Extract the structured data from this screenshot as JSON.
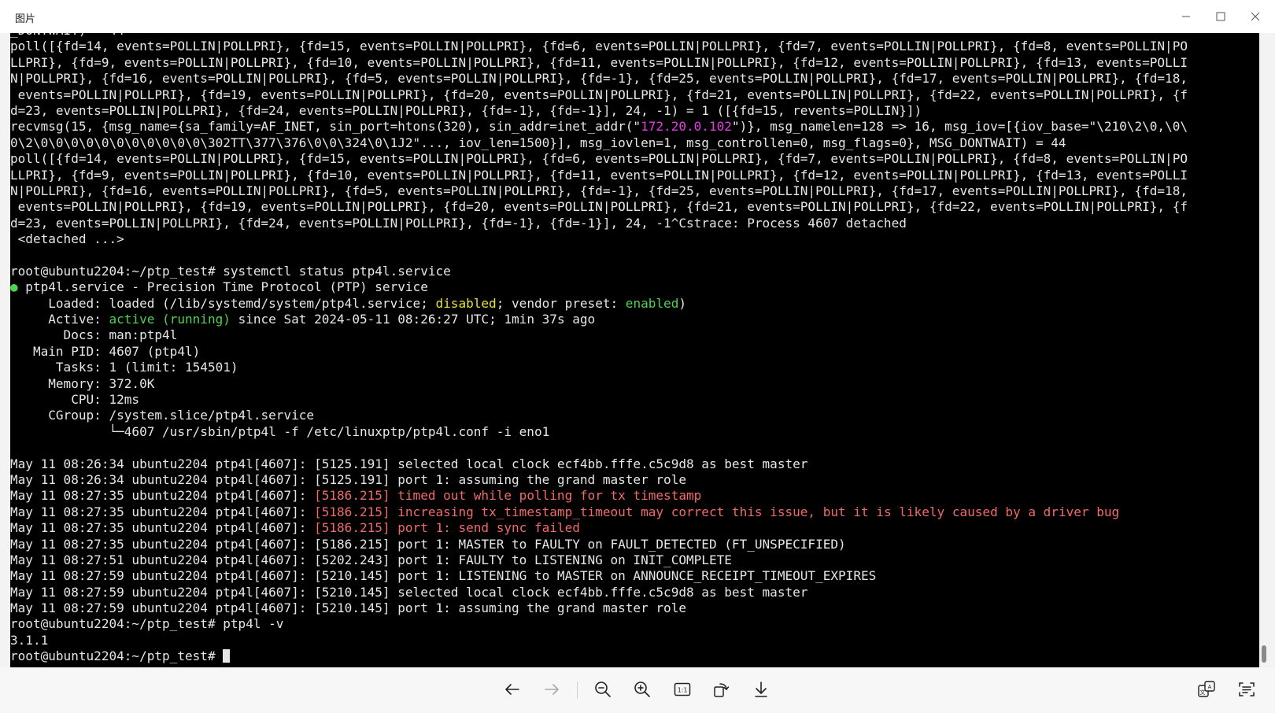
{
  "window": {
    "title": "图片"
  },
  "terminal": {
    "lines": [
      [
        {
          "t": "_DONTWAIT) = 44"
        }
      ],
      [
        {
          "t": "poll([{fd=14, events=POLLIN|POLLPRI}, {fd=15, events=POLLIN|POLLPRI}, {fd=6, events=POLLIN|POLLPRI}, {fd=7, events=POLLIN|POLLPRI}, {fd=8, events=POLLIN|PO"
        }
      ],
      [
        {
          "t": "LLPRI}, {fd=9, events=POLLIN|POLLPRI}, {fd=10, events=POLLIN|POLLPRI}, {fd=11, events=POLLIN|POLLPRI}, {fd=12, events=POLLIN|POLLPRI}, {fd=13, events=POLLI"
        }
      ],
      [
        {
          "t": "N|POLLPRI}, {fd=16, events=POLLIN|POLLPRI}, {fd=5, events=POLLIN|POLLPRI}, {fd=-1}, {fd=25, events=POLLIN|POLLPRI}, {fd=17, events=POLLIN|POLLPRI}, {fd=18,"
        }
      ],
      [
        {
          "t": " events=POLLIN|POLLPRI}, {fd=19, events=POLLIN|POLLPRI}, {fd=20, events=POLLIN|POLLPRI}, {fd=21, events=POLLIN|POLLPRI}, {fd=22, events=POLLIN|POLLPRI}, {f"
        }
      ],
      [
        {
          "t": "d=23, events=POLLIN|POLLPRI}, {fd=24, events=POLLIN|POLLPRI}, {fd=-1}, {fd=-1}], 24, -1) = 1 ([{fd=15, revents=POLLIN}])"
        }
      ],
      [
        {
          "t": "recvmsg(15, {msg_name={sa_family=AF_INET, sin_port=htons(320), sin_addr=inet_addr(\""
        },
        {
          "t": "172.20.0.102",
          "c": "magenta"
        },
        {
          "t": "\")}, msg_namelen=128 => 16, msg_iov=[{iov_base=\"\\210\\2\\0,\\0\\"
        }
      ],
      [
        {
          "t": "0\\2\\0\\0\\0\\0\\0\\0\\0\\0\\0\\0\\0\\302TT\\377\\376\\0\\0\\324\\0\\1J2\"..., iov_len=1500}], msg_iovlen=1, msg_controllen=0, msg_flags=0}, MSG_DONTWAIT) = 44"
        }
      ],
      [
        {
          "t": "poll([{fd=14, events=POLLIN|POLLPRI}, {fd=15, events=POLLIN|POLLPRI}, {fd=6, events=POLLIN|POLLPRI}, {fd=7, events=POLLIN|POLLPRI}, {fd=8, events=POLLIN|PO"
        }
      ],
      [
        {
          "t": "LLPRI}, {fd=9, events=POLLIN|POLLPRI}, {fd=10, events=POLLIN|POLLPRI}, {fd=11, events=POLLIN|POLLPRI}, {fd=12, events=POLLIN|POLLPRI}, {fd=13, events=POLLI"
        }
      ],
      [
        {
          "t": "N|POLLPRI}, {fd=16, events=POLLIN|POLLPRI}, {fd=5, events=POLLIN|POLLPRI}, {fd=-1}, {fd=25, events=POLLIN|POLLPRI}, {fd=17, events=POLLIN|POLLPRI}, {fd=18,"
        }
      ],
      [
        {
          "t": " events=POLLIN|POLLPRI}, {fd=19, events=POLLIN|POLLPRI}, {fd=20, events=POLLIN|POLLPRI}, {fd=21, events=POLLIN|POLLPRI}, {fd=22, events=POLLIN|POLLPRI}, {f"
        }
      ],
      [
        {
          "t": "d=23, events=POLLIN|POLLPRI}, {fd=24, events=POLLIN|POLLPRI}, {fd=-1}, {fd=-1}], 24, -1^Cstrace: Process 4607 detached"
        }
      ],
      [
        {
          "t": " <detached ...>"
        }
      ],
      [
        {
          "t": ""
        }
      ],
      [
        {
          "t": "root@ubuntu2204:~/ptp_test# systemctl status ptp4l.service"
        }
      ],
      [
        {
          "t": "●",
          "c": "green"
        },
        {
          "t": " ptp4l.service - Precision Time Protocol (PTP) service"
        }
      ],
      [
        {
          "t": "     Loaded: loaded (/lib/systemd/system/ptp4l.service; "
        },
        {
          "t": "disabled",
          "c": "yellow"
        },
        {
          "t": "; vendor preset: "
        },
        {
          "t": "enabled",
          "c": "green"
        },
        {
          "t": ")"
        }
      ],
      [
        {
          "t": "     Active: "
        },
        {
          "t": "active (running)",
          "c": "green"
        },
        {
          "t": " since Sat 2024-05-11 08:26:27 UTC; 1min 37s ago"
        }
      ],
      [
        {
          "t": "       Docs: man:ptp4l"
        }
      ],
      [
        {
          "t": "   Main PID: 4607 (ptp4l)"
        }
      ],
      [
        {
          "t": "      Tasks: 1 (limit: 154501)"
        }
      ],
      [
        {
          "t": "     Memory: 372.0K"
        }
      ],
      [
        {
          "t": "        CPU: 12ms"
        }
      ],
      [
        {
          "t": "     CGroup: /system.slice/ptp4l.service"
        }
      ],
      [
        {
          "t": "             └─4607 /usr/sbin/ptp4l -f /etc/linuxptp/ptp4l.conf -i eno1"
        }
      ],
      [
        {
          "t": ""
        }
      ],
      [
        {
          "t": "May 11 08:26:34 ubuntu2204 ptp4l[4607]: [5125.191] selected local clock ecf4bb.fffe.c5c9d8 as best master"
        }
      ],
      [
        {
          "t": "May 11 08:26:34 ubuntu2204 ptp4l[4607]: [5125.191] port 1: assuming the grand master role"
        }
      ],
      [
        {
          "t": "May 11 08:27:35 ubuntu2204 ptp4l[4607]: "
        },
        {
          "t": "[5186.215] timed out while polling for tx timestamp",
          "c": "red"
        }
      ],
      [
        {
          "t": "May 11 08:27:35 ubuntu2204 ptp4l[4607]: "
        },
        {
          "t": "[5186.215] increasing tx_timestamp_timeout may correct this issue, but it is likely caused by a driver bug",
          "c": "red"
        }
      ],
      [
        {
          "t": "May 11 08:27:35 ubuntu2204 ptp4l[4607]: "
        },
        {
          "t": "[5186.215] port 1: send sync failed",
          "c": "red"
        }
      ],
      [
        {
          "t": "May 11 08:27:35 ubuntu2204 ptp4l[4607]: [5186.215] port 1: MASTER to FAULTY on FAULT_DETECTED (FT_UNSPECIFIED)"
        }
      ],
      [
        {
          "t": "May 11 08:27:51 ubuntu2204 ptp4l[4607]: [5202.243] port 1: FAULTY to LISTENING on INIT_COMPLETE"
        }
      ],
      [
        {
          "t": "May 11 08:27:59 ubuntu2204 ptp4l[4607]: [5210.145] port 1: LISTENING to MASTER on ANNOUNCE_RECEIPT_TIMEOUT_EXPIRES"
        }
      ],
      [
        {
          "t": "May 11 08:27:59 ubuntu2204 ptp4l[4607]: [5210.145] selected local clock ecf4bb.fffe.c5c9d8 as best master"
        }
      ],
      [
        {
          "t": "May 11 08:27:59 ubuntu2204 ptp4l[4607]: [5210.145] port 1: assuming the grand master role"
        }
      ],
      [
        {
          "t": "root@ubuntu2204:~/ptp_test# ptp4l -v"
        }
      ],
      [
        {
          "t": "3.1.1"
        }
      ],
      [
        {
          "t": "root@ubuntu2204:~/ptp_test# "
        }
      ]
    ]
  },
  "toolbar": {
    "buttons": [
      {
        "name": "back-button",
        "icon": "arrow-left-icon"
      },
      {
        "name": "forward-button",
        "icon": "arrow-right-icon"
      },
      {
        "name": "zoom-out-button",
        "icon": "zoom-out-icon"
      },
      {
        "name": "zoom-in-button",
        "icon": "zoom-in-icon"
      },
      {
        "name": "actual-size-button",
        "icon": "actual-size-icon"
      },
      {
        "name": "rotate-button",
        "icon": "rotate-icon"
      },
      {
        "name": "download-button",
        "icon": "download-icon"
      },
      {
        "name": "translate-button",
        "icon": "translate-icon"
      },
      {
        "name": "text-recognition-button",
        "icon": "text-scan-icon"
      }
    ]
  },
  "colors": {
    "terminal_bg": "#000000",
    "terminal_fg": "#e6e6e6",
    "magenta": "#e040e0",
    "yellow": "#e7e23a",
    "green": "#4fd152",
    "red": "#f06a6a"
  }
}
